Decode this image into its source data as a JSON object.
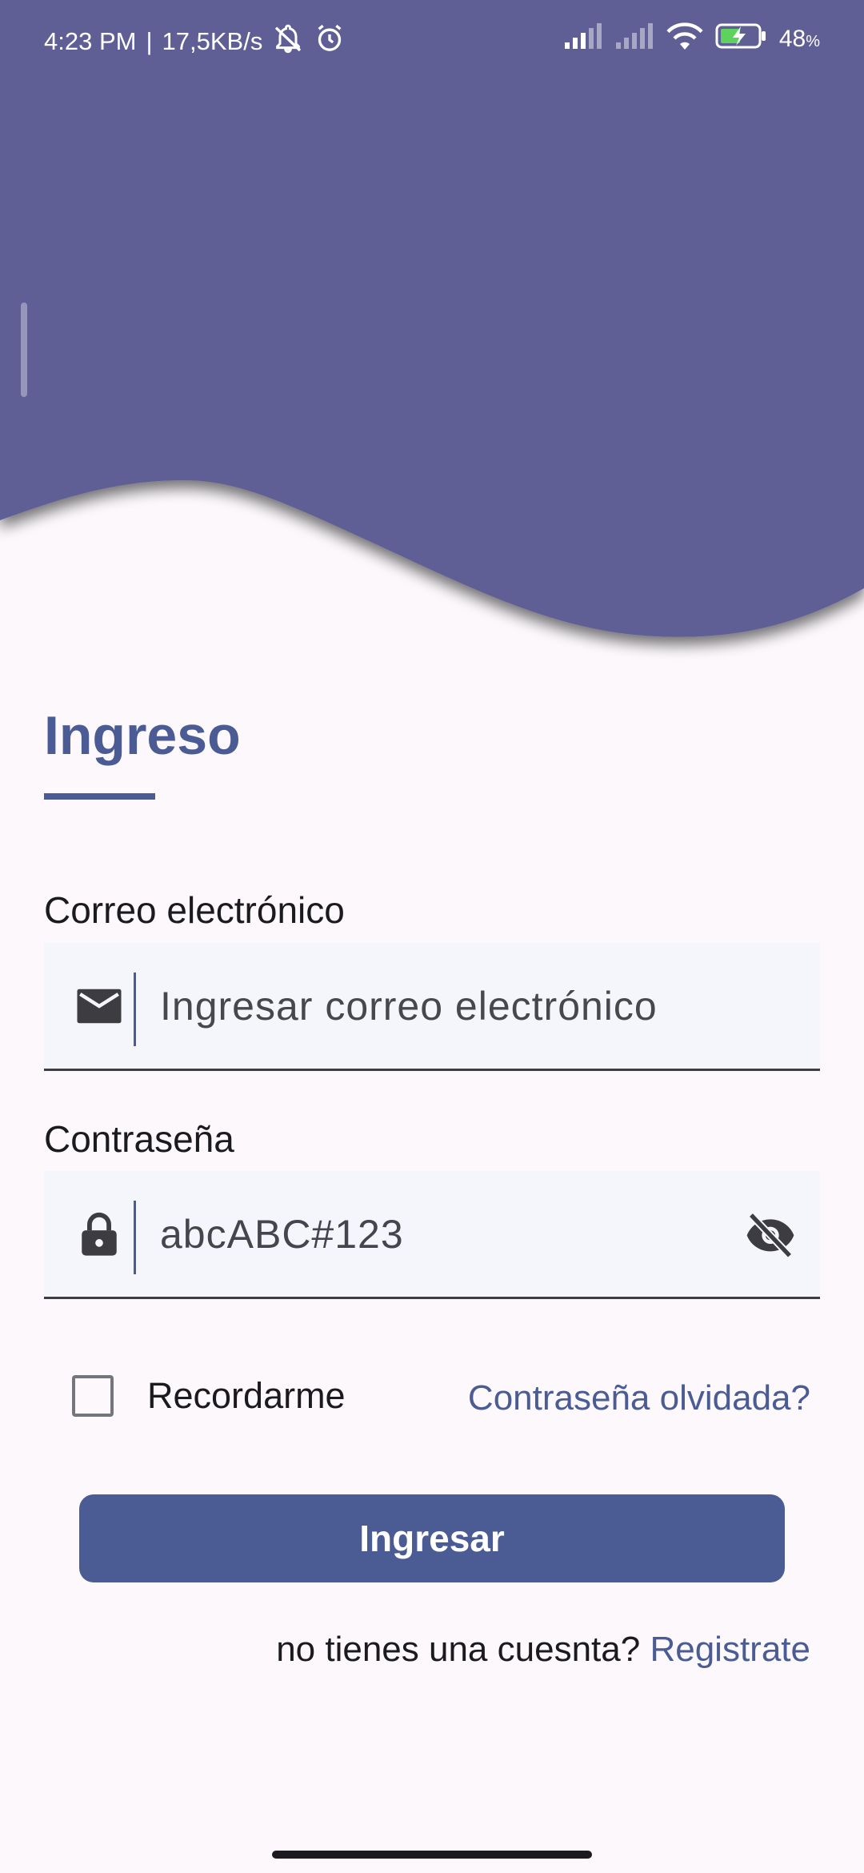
{
  "status_bar": {
    "time": "4:23 PM",
    "network_speed": "17,5KB/s",
    "separator": "|",
    "battery_percent": "48",
    "battery_unit": "%"
  },
  "login": {
    "title": "Ingreso",
    "email_label": "Correo electrónico",
    "email_placeholder": "Ingresar correo electrónico",
    "password_label": "Contraseña",
    "password_value": "abcABC#123",
    "remember_label": "Recordarme",
    "forgot_password": "Contraseña olvidada?",
    "submit_label": "Ingresar",
    "no_account_text": "no tienes una cuesnta?",
    "register_link": "Registrate"
  },
  "colors": {
    "header_bg": "#5f5f96",
    "accent": "#4a5c93",
    "field_bg": "#f4f6fb",
    "page_bg": "#fcf8fc"
  },
  "icons": {
    "status": [
      "notifications-off-icon",
      "alarm-icon",
      "signal-icon",
      "signal-icon",
      "wifi-icon",
      "battery-charging-icon"
    ],
    "email_field": "mail-icon",
    "password_field": "lock-icon",
    "password_toggle": "visibility-off-icon"
  }
}
